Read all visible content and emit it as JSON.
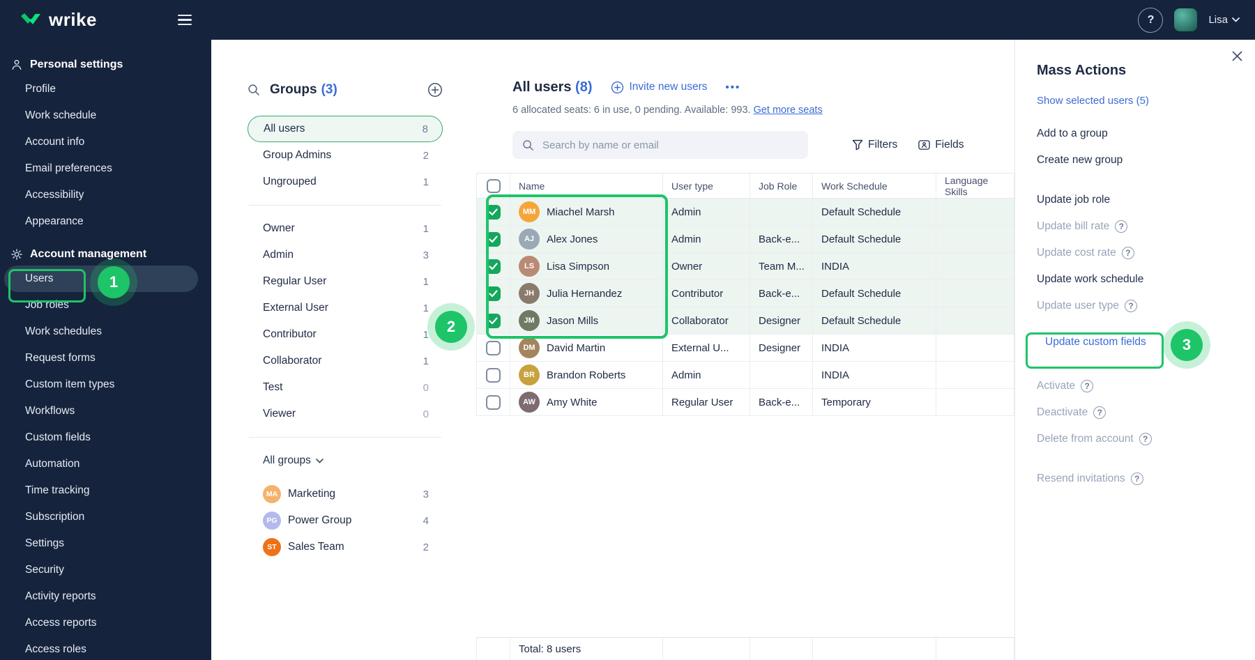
{
  "topbar": {
    "brand": "wrike",
    "user_name": "Lisa"
  },
  "icons": {
    "question": "?",
    "more": "•••",
    "search": "magnifier",
    "add": "plus-circle",
    "filters": "funnel",
    "fields": "badge-person",
    "close": "x",
    "chevron": "chevron-down"
  },
  "sidebar": {
    "sections": [
      {
        "label": "Personal settings",
        "icon": "person-icon",
        "items": [
          {
            "label": "Profile"
          },
          {
            "label": "Work schedule"
          },
          {
            "label": "Account info"
          },
          {
            "label": "Email preferences"
          },
          {
            "label": "Accessibility"
          },
          {
            "label": "Appearance"
          }
        ]
      },
      {
        "label": "Account management",
        "icon": "gear-icon",
        "items": [
          {
            "label": "Users",
            "selected": true
          },
          {
            "label": "Job roles"
          },
          {
            "label": "Work schedules"
          },
          {
            "label": "Request forms"
          },
          {
            "label": "Custom item types"
          },
          {
            "label": "Workflows"
          },
          {
            "label": "Custom fields"
          },
          {
            "label": "Automation"
          },
          {
            "label": "Time tracking"
          },
          {
            "label": "Subscription"
          },
          {
            "label": "Settings"
          },
          {
            "label": "Security"
          },
          {
            "label": "Activity reports"
          },
          {
            "label": "Access reports"
          },
          {
            "label": "Access roles"
          }
        ]
      }
    ]
  },
  "groups_panel": {
    "title": "Groups",
    "count": "(3)",
    "items": [
      {
        "label": "All users",
        "count": "8",
        "selected": true
      },
      {
        "label": "Group Admins",
        "count": "2"
      },
      {
        "label": "Ungrouped",
        "count": "1"
      },
      {
        "label": "Owner",
        "count": "1"
      },
      {
        "label": "Admin",
        "count": "3"
      },
      {
        "label": "Regular User",
        "count": "1"
      },
      {
        "label": "External User",
        "count": "1"
      },
      {
        "label": "Contributor",
        "count": "1"
      },
      {
        "label": "Collaborator",
        "count": "1"
      },
      {
        "label": "Test",
        "count": "0"
      },
      {
        "label": "Viewer",
        "count": "0"
      }
    ],
    "all_groups_label": "All groups",
    "groups": [
      {
        "initials": "MA",
        "label": "Marketing",
        "count": "3",
        "color": "#f6b26b"
      },
      {
        "initials": "PG",
        "label": "Power Group",
        "count": "4",
        "color": "#b3baeb"
      },
      {
        "initials": "ST",
        "label": "Sales Team",
        "count": "2",
        "color": "#f07119"
      }
    ]
  },
  "users_panel": {
    "title": "All users",
    "title_count": "(8)",
    "invite_label": "Invite new users",
    "seats_text": "6 allocated seats: 6 in use, 0 pending. Available: 993.",
    "seats_link": "Get more seats",
    "search_placeholder": "Search by name or email",
    "filters_label": "Filters",
    "fields_label": "Fields",
    "columns": [
      "Name",
      "User type",
      "Job Role",
      "Work Schedule",
      "Language Skills"
    ],
    "rows": [
      {
        "name": "Miachel Marsh",
        "initials": "MM",
        "avatar_color": "#f5a63b",
        "user_type": "Admin",
        "job_role": "",
        "work_schedule": "Default Schedule",
        "language_skills": "",
        "checked": true
      },
      {
        "name": "Alex Jones",
        "initials": "AJ",
        "avatar_color": "#9aa9b5",
        "user_type": "Admin",
        "job_role": "Back-e...",
        "work_schedule": "Default Schedule",
        "language_skills": "",
        "checked": true
      },
      {
        "name": "Lisa Simpson",
        "initials": "LS",
        "avatar_color": "#b98a74",
        "user_type": "Owner",
        "job_role": "Team M...",
        "work_schedule": "INDIA",
        "language_skills": "",
        "checked": true
      },
      {
        "name": "Julia Hernandez",
        "initials": "JH",
        "avatar_color": "#8a7a6b",
        "user_type": "Contributor",
        "job_role": "Back-e...",
        "work_schedule": "Default Schedule",
        "language_skills": "",
        "checked": true
      },
      {
        "name": "Jason Mills",
        "initials": "JM",
        "avatar_color": "#6e7a63",
        "user_type": "Collaborator",
        "job_role": "Designer",
        "work_schedule": "Default Schedule",
        "language_skills": "",
        "checked": true
      },
      {
        "name": "David Martin",
        "initials": "DM",
        "avatar_color": "#a3845f",
        "user_type": "External U...",
        "job_role": "Designer",
        "work_schedule": "INDIA",
        "language_skills": "",
        "checked": false
      },
      {
        "name": "Brandon Roberts",
        "initials": "BR",
        "avatar_color": "#c7a23e",
        "user_type": "Admin",
        "job_role": "",
        "work_schedule": "INDIA",
        "language_skills": "",
        "checked": false
      },
      {
        "name": "Amy White",
        "initials": "AW",
        "avatar_color": "#7d6b70",
        "user_type": "Regular User",
        "job_role": "Back-e...",
        "work_schedule": "Temporary",
        "language_skills": "",
        "checked": false
      }
    ],
    "total_label": "Total: 8 users"
  },
  "mass_panel": {
    "title": "Mass Actions",
    "show_selected_label": "Show selected users (5)",
    "actions": [
      {
        "label": "Add to a group",
        "state": "enabled"
      },
      {
        "label": "Create new group",
        "state": "enabled"
      },
      {
        "label": "Update job role",
        "state": "enabled"
      },
      {
        "label": "Update bill rate",
        "state": "disabled",
        "help": true
      },
      {
        "label": "Update cost rate",
        "state": "disabled",
        "help": true
      },
      {
        "label": "Update work schedule",
        "state": "enabled"
      },
      {
        "label": "Update user type",
        "state": "disabled",
        "help": true
      },
      {
        "label": "Update custom fields",
        "state": "link",
        "annotated": true
      },
      {
        "label": "Activate",
        "state": "disabled",
        "help": true
      },
      {
        "label": "Deactivate",
        "state": "disabled",
        "help": true
      },
      {
        "label": "Delete from account",
        "state": "disabled",
        "help": true
      },
      {
        "label": "Resend invitations",
        "state": "disabled",
        "help": true
      }
    ]
  },
  "annotations": {
    "step1": "1",
    "step2": "2",
    "step3": "3"
  },
  "colors": {
    "navy": "#16233c",
    "accent_blue": "#3b6bd6",
    "annotation_green": "#1ec468",
    "checkbox_green": "#14a75d",
    "selected_row": "#edf5f0",
    "selected_group_bg": "#eef7f2"
  }
}
